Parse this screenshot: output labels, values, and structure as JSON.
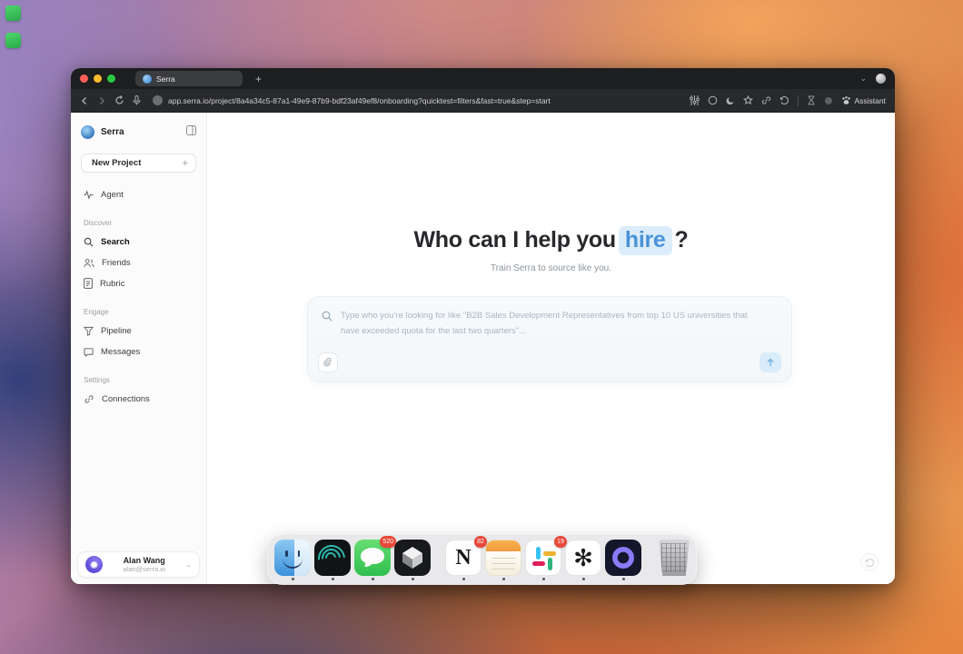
{
  "browser": {
    "tab_title": "Serra",
    "new_tab_label": "+",
    "url": "app.serra.io/project/8a4a34c5-87a1-49e9-87b9-bdf23af49ef8/onboarding?quicktest=filters&fast=true&step=start",
    "assistant_label": "Assistant"
  },
  "sidebar": {
    "brand": "Serra",
    "new_project_label": "New Project",
    "new_project_plus": "+",
    "agent_label": "Agent",
    "sections": [
      {
        "title": "Discover",
        "items": [
          {
            "label": "Search"
          },
          {
            "label": "Friends"
          },
          {
            "label": "Rubric"
          }
        ]
      },
      {
        "title": "Engage",
        "items": [
          {
            "label": "Pipeline"
          },
          {
            "label": "Messages"
          }
        ]
      },
      {
        "title": "Settings",
        "items": [
          {
            "label": "Connections"
          }
        ]
      }
    ],
    "user": {
      "name": "Alan Wang",
      "email": "alan@serra.io",
      "chevron": "⌄"
    }
  },
  "main": {
    "title_prefix": "Who can I help you",
    "title_highlight": "hire",
    "title_suffix": "?",
    "subtitle": "Train Serra to source like you.",
    "search_placeholder": "Type who you're looking for like \"B2B Sales Development Representatives from top 10 US universities that have exceeded quota for the last two quarters\"..."
  },
  "dock": {
    "badges": {
      "messages": "520",
      "notion": "82",
      "slack": "19"
    }
  },
  "colors": {
    "accent_blue": "#4a93d9",
    "highlight_bg": "#dcecfa",
    "badge_red": "#e8493a",
    "traffic_red": "#ff5f57",
    "traffic_yellow": "#febc2e",
    "traffic_green": "#28c840"
  }
}
